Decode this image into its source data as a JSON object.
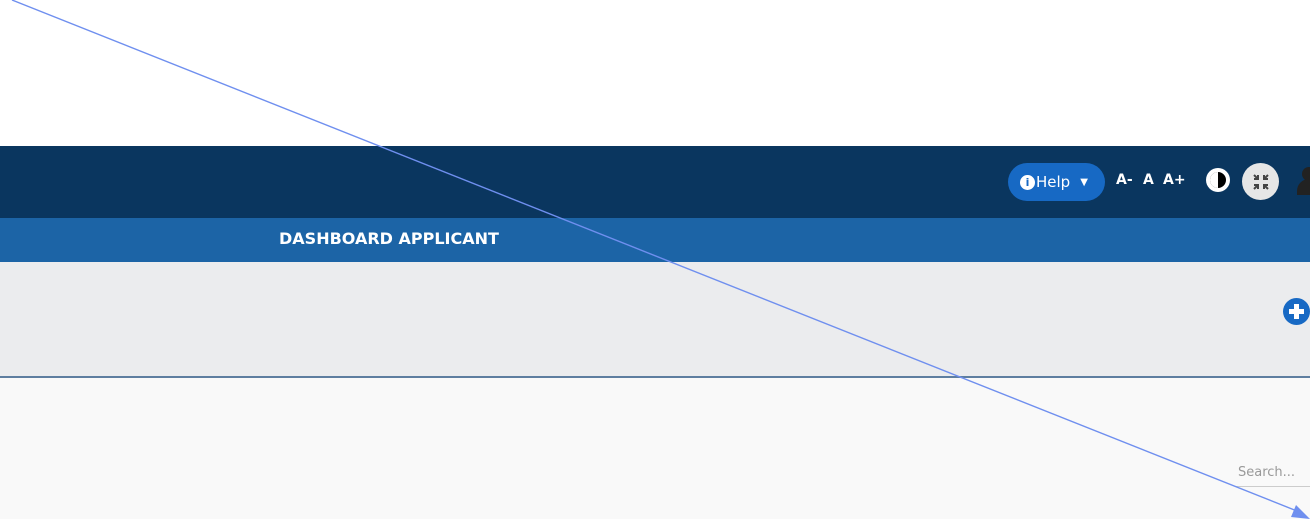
{
  "header": {
    "help_label": "Help",
    "font_decrease_label": "A-",
    "font_normal_label": "A",
    "font_increase_label": "A+"
  },
  "subnav": {
    "title": "DASHBOARD APPLICANT"
  },
  "search": {
    "placeholder": "Search..."
  },
  "colors": {
    "navbar": "#0a365f",
    "subnav": "#1c64a6",
    "accent": "#1769c4",
    "gray_bar": "#ebecee",
    "arrow": "#6f8fef"
  },
  "icons": {
    "help_info": "info-icon",
    "help_caret": "caret-down-icon",
    "contrast": "contrast-icon",
    "compress": "compress-icon",
    "user": "user-icon",
    "add": "plus-circle-icon"
  }
}
